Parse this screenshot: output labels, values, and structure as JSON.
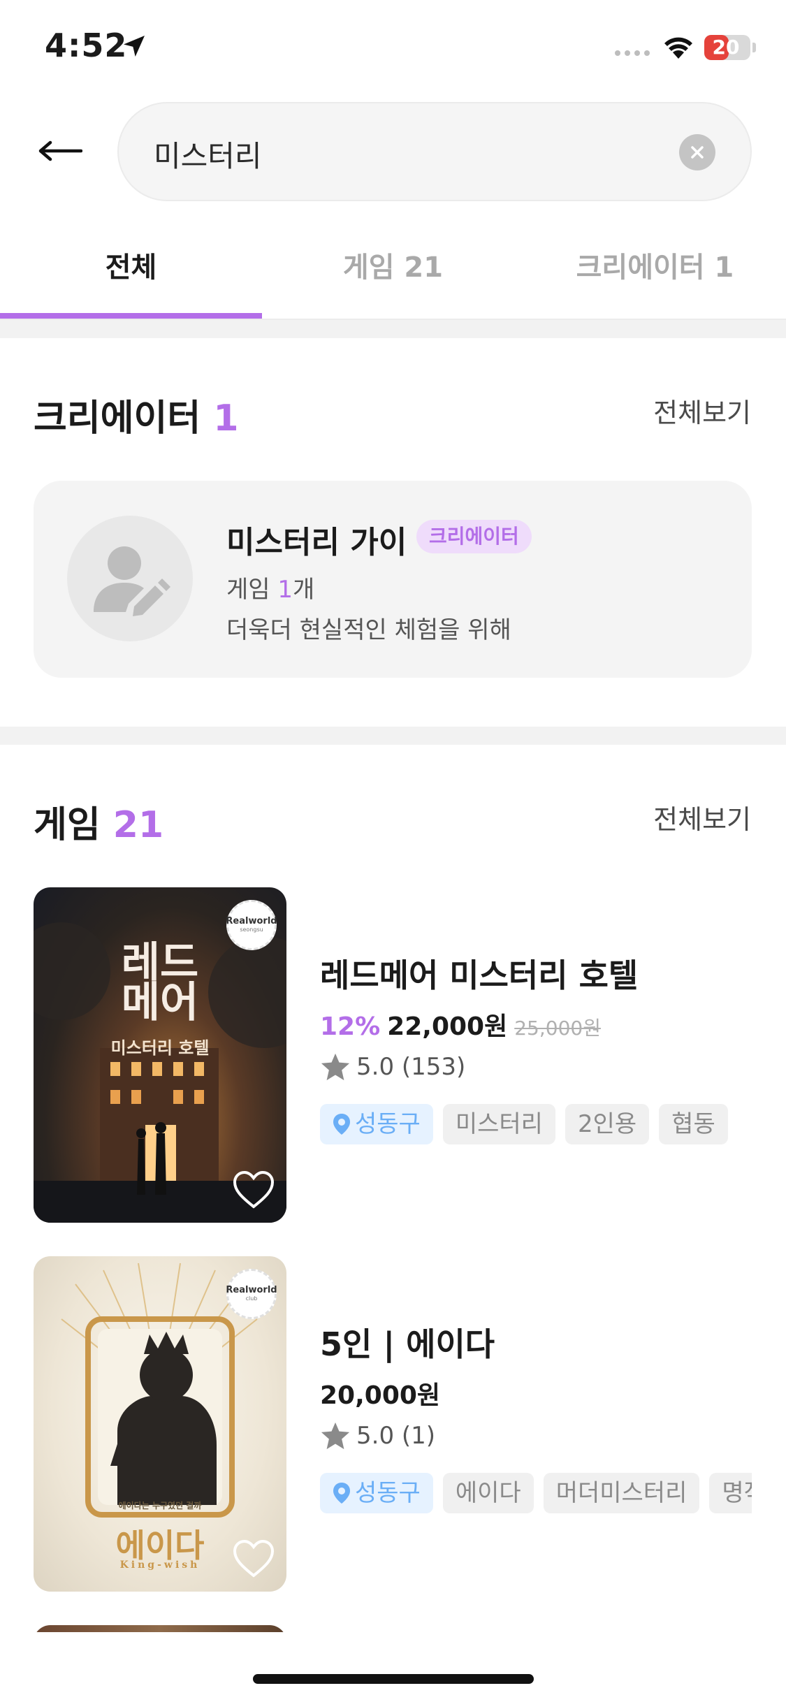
{
  "status_bar": {
    "time": "4:52",
    "battery": "20",
    "battery_level": 0.2
  },
  "search": {
    "query": "미스터리"
  },
  "tabs": [
    {
      "label": "전체",
      "active": true
    },
    {
      "label": "게임 21",
      "active": false
    },
    {
      "label": "크리에이터 1",
      "active": false
    }
  ],
  "creators_section": {
    "title": "크리에이터",
    "count": "1",
    "see_all": "전체보기",
    "creator": {
      "name": "미스터리 가이",
      "badge": "크리에이터",
      "games_prefix": "게임 ",
      "games_count": "1",
      "games_suffix": "개",
      "description": "더욱더 현실적인 체험을 위해"
    }
  },
  "games_section": {
    "title": "게임",
    "count": "21",
    "see_all": "전체보기",
    "items": [
      {
        "title": "레드메어 미스터리 호텔",
        "discount": "12%",
        "price": "22,000원",
        "original_price": "25,000원",
        "rating": "5.0 (153)",
        "tags": [
          "성동구",
          "미스터리",
          "2인용",
          "협동"
        ],
        "poster_text": [
          "레드",
          "메어",
          "미스터리 호텔"
        ],
        "logo_text": [
          "Realworld",
          "seongsu"
        ]
      },
      {
        "title": "5인 | 에이다",
        "price": "20,000원",
        "rating": "5.0 (1)",
        "tags": [
          "성동구",
          "에이다",
          "머더미스터리",
          "명작"
        ],
        "poster_text": [
          "에이다는 누구였던 걸까",
          "에이다",
          "King-wish"
        ],
        "logo_text": [
          "Realworld",
          "club"
        ]
      }
    ]
  },
  "colors": {
    "accent": "#b36ee8",
    "location_tag": "#6aaef6",
    "battery_low": "#e5423b"
  }
}
